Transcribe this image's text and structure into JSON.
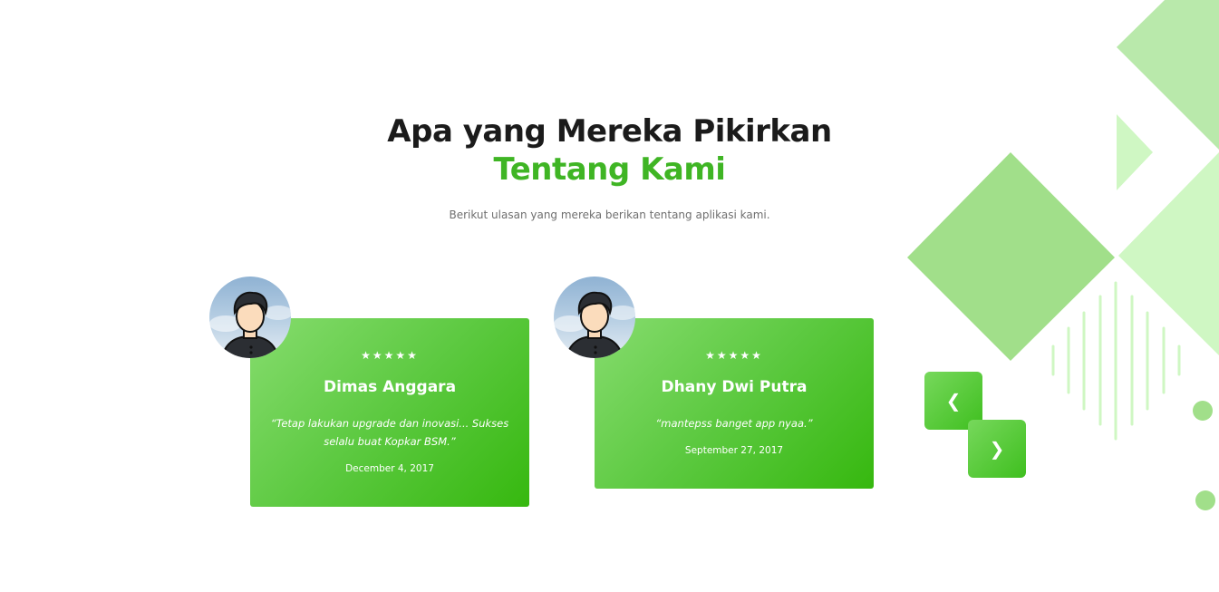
{
  "section": {
    "title_line1": "Apa yang Mereka Pikirkan",
    "title_line2": "Tentang Kami",
    "subtitle": "Berikut ulasan yang mereka berikan tentang aplikasi kami."
  },
  "testimonials": [
    {
      "rating": 5,
      "stars": "★★★★★",
      "name": "Dimas Anggara",
      "quote": "“Tetap lakukan upgrade dan inovasi... Sukses selalu buat Kopkar BSM.”",
      "date": "December 4, 2017",
      "avatar_icon": "user-avatar-icon"
    },
    {
      "rating": 5,
      "stars": "★★★★★",
      "name": "Dhany Dwi Putra",
      "quote": "“mantepss banget app nyaa.”",
      "date": "September 27, 2017",
      "avatar_icon": "user-avatar-icon"
    }
  ],
  "carousel": {
    "prev_label": "❮",
    "next_label": "❯",
    "prev_icon": "chevron-left-icon",
    "next_icon": "chevron-right-icon"
  },
  "colors": {
    "accent": "#3fb524",
    "heading": "#1b1b1b",
    "card_gradient_start": "#86dc6e",
    "card_gradient_end": "#36b80f",
    "deco_light": "#cff7c3",
    "deco_mid": "#b9e9ab",
    "deco_dark": "#a1df8a"
  }
}
